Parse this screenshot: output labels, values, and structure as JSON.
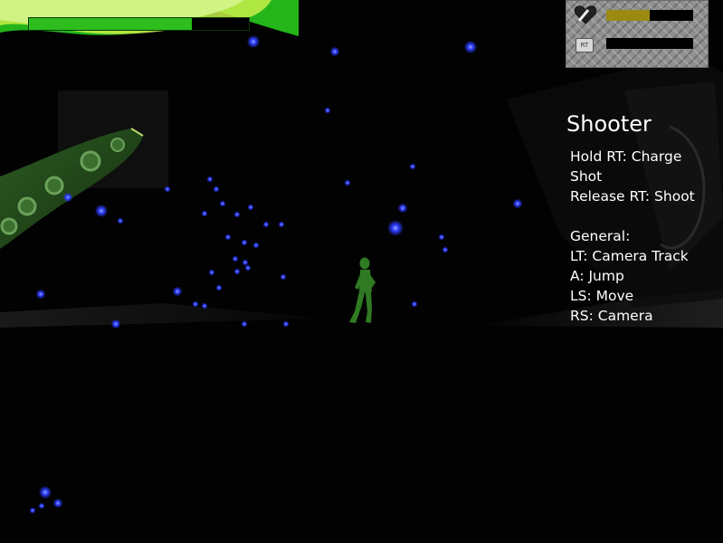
{
  "hud": {
    "health": {
      "level": 0.74,
      "fill_color": "#2dbd1c"
    },
    "status_panel": {
      "life": {
        "icon": "heart-icon",
        "level": 0.5,
        "fill_color": "#9a8a10"
      },
      "charge": {
        "icon": "rt-trigger-icon",
        "label": "RT",
        "level": 0.0,
        "fill_color": "#9a8a10"
      }
    }
  },
  "controls": {
    "title": "Shooter",
    "lines": [
      "Hold RT: Charge",
      "Shot",
      "Release RT: Shoot",
      "",
      "General:",
      "LT: Camera Track",
      "A: Jump",
      "LS: Move",
      "RS: Camera"
    ]
  },
  "scene": {
    "character_color": "#2f7a22",
    "particle_color": "#2b3cff"
  }
}
